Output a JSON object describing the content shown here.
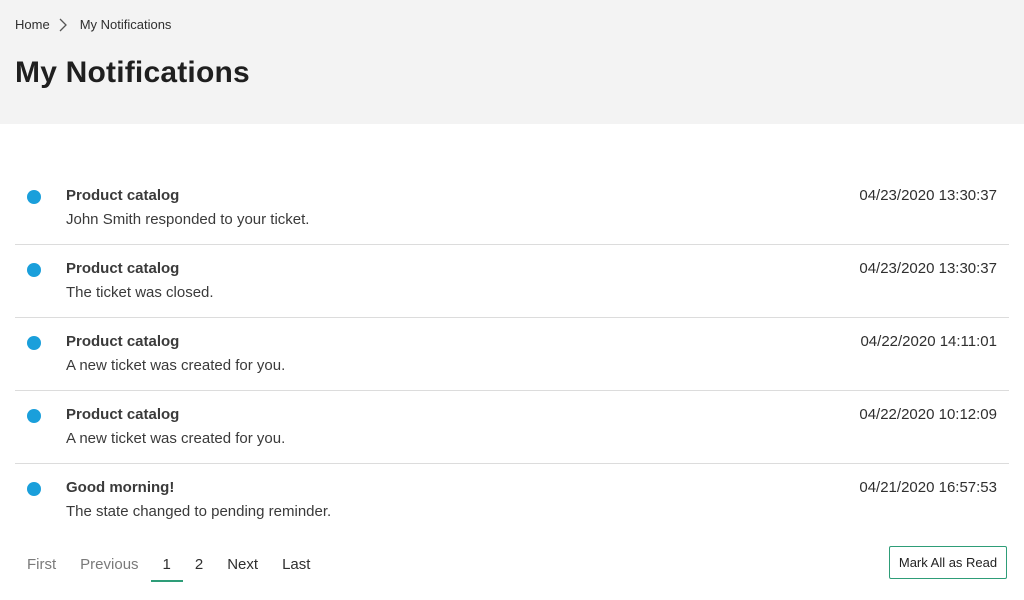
{
  "breadcrumb": {
    "home": "Home",
    "current": "My Notifications"
  },
  "page_title": "My Notifications",
  "notifications": [
    {
      "title": "Product catalog",
      "text": "John Smith responded to your ticket.",
      "time": "04/23/2020 13:30:37",
      "unread": true
    },
    {
      "title": "Product catalog",
      "text": "The ticket was closed.",
      "time": "04/23/2020 13:30:37",
      "unread": true
    },
    {
      "title": "Product catalog",
      "text": "A new ticket was created for you.",
      "time": "04/22/2020 14:11:01",
      "unread": true
    },
    {
      "title": "Product catalog",
      "text": "A new ticket was created for you.",
      "time": "04/22/2020 10:12:09",
      "unread": true
    },
    {
      "title": "Good morning!",
      "text": "The state changed to pending reminder.",
      "time": "04/21/2020 16:57:53",
      "unread": true
    }
  ],
  "pagination": {
    "first": "First",
    "previous": "Previous",
    "pages": [
      "1",
      "2"
    ],
    "current_page": "1",
    "next": "Next",
    "last": "Last"
  },
  "actions": {
    "mark_all_read": "Mark All as Read"
  },
  "colors": {
    "unread_dot": "#1a9fdb",
    "accent": "#2e9d78",
    "header_bg": "#f3f3f3"
  },
  "icons": {
    "breadcrumb_separator": "chevron-right-icon",
    "unread_indicator": "unread-dot-icon"
  }
}
